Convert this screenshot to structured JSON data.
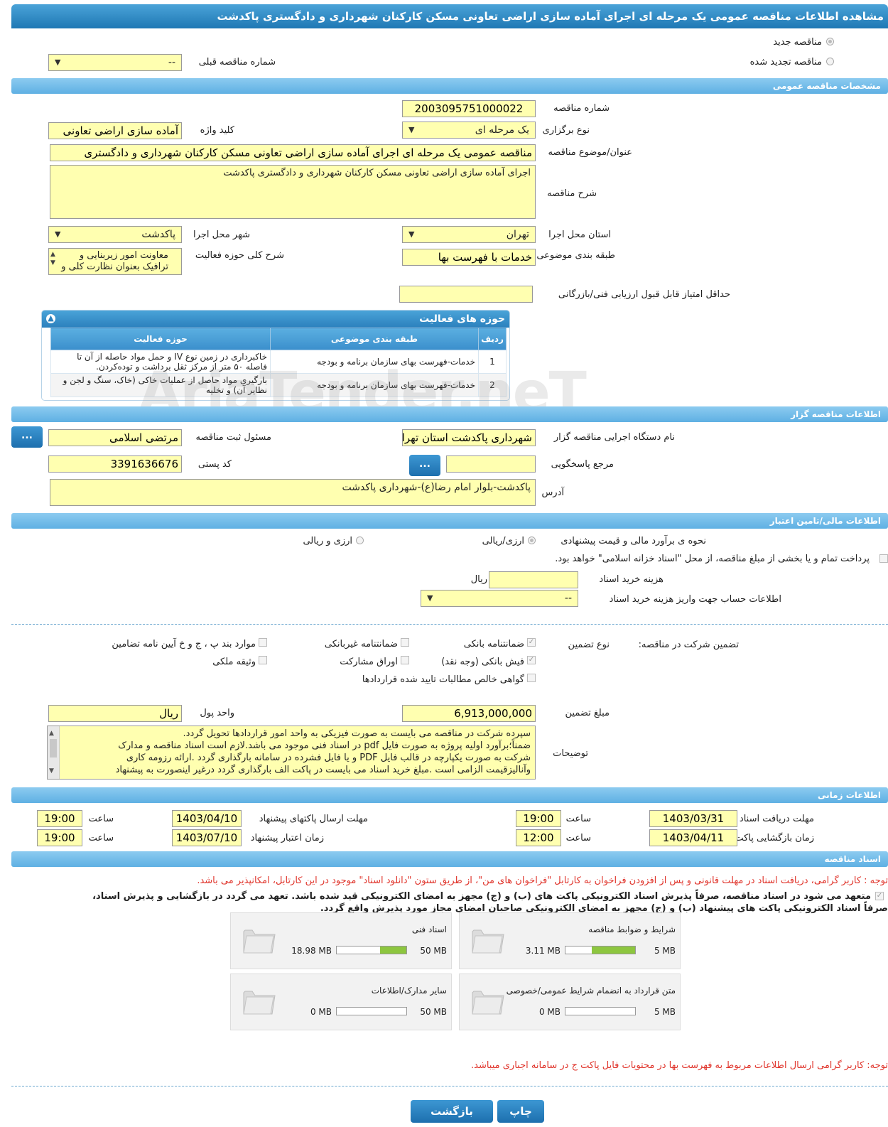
{
  "header": {
    "title": "مشاهده اطلاعات مناقصه عمومی یک مرحله ای اجرای آماده سازی اراضی تعاونی مسکن کارکنان شهرداری و دادگستری پاکدشت"
  },
  "top": {
    "new_tender": "مناقصه جدید",
    "renewed_tender": "مناقصه تجدید شده",
    "prev_number_label": "شماره مناقصه قبلی",
    "prev_number_value": "--"
  },
  "general": {
    "section": "مشخصات مناقصه عمومی",
    "number_label": "شماره مناقصه",
    "number_value": "2003095751000022",
    "type_label": "نوع برگزاری",
    "type_value": "یک مرحله ای",
    "keyword_label": "کلید واژه",
    "keyword_value": "آماده سازی اراضی تعاونی",
    "title_label": "عنوان/موضوع مناقصه",
    "title_value": "مناقصه عمومی یک مرحله ای اجرای آماده سازی اراضی تعاونی مسکن کارکنان شهرداری و دادگستری",
    "desc_label": "شرح مناقصه",
    "desc_value": "اجرای آماده سازی اراضی تعاونی مسکن کارکنان شهرداری و دادگستری پاکدشت",
    "province_label": "استان محل اجرا",
    "province_value": "تهران",
    "city_label": "شهر محل اجرا",
    "city_value": "پاکدشت",
    "category_label": "طبقه بندی موضوعی",
    "category_value": "خدمات با فهرست بها",
    "activity_label": "شرح کلی حوزه فعالیت",
    "activity_line1": "معاونت امور زیربنایی و",
    "activity_line2": "ترافیک بعنوان نظارت کلی و",
    "min_score_label": "حداقل امتیاز قابل قبول ارزیابی فنی/بازرگانی",
    "min_score_value": ""
  },
  "activities": {
    "title": "حوزه های فعالیت",
    "headers": [
      "ردیف",
      "طبقه بندی موضوعی",
      "حوزه فعالیت"
    ],
    "rows": [
      {
        "n": "1",
        "cat": "خدمات-فهرست بهای سازمان برنامه و بودجه",
        "act": "خاکبرداری در زمین نوع IV و حمل مواد حاصله از آن تا فاصله ۵۰ متر از مرکز ثقل برداشت و توده‌کردن."
      },
      {
        "n": "2",
        "cat": "خدمات-فهرست بهای سازمان برنامه و بودجه",
        "act": "بارگیری مواد حاصل از عملیات خاکی (خاک، سنگ و لجن و نظایر آن) و تخلیه"
      }
    ]
  },
  "watermark": "AriaTender.neT",
  "org": {
    "section": "اطلاعات مناقصه گزار",
    "name_label": "نام دستگاه اجرایی مناقصه گزار",
    "name_value": "شهرداری پاکدشت استان تهران",
    "resp_label": "مسئول ثبت مناقصه",
    "resp_value": "مرتضی اسلامی",
    "ref_label": "مرجع پاسخگویی",
    "ref_value": "",
    "postal_label": "کد پستی",
    "postal_value": "3391636676",
    "address_label": "آدرس",
    "address_value": "پاکدشت-بلوار امام رضا(ع)-شهرداری پاکدشت",
    "dots": "..."
  },
  "finance": {
    "section": "اطلاعات مالی/تامین اعتبار",
    "estimate_label": "نحوه ی برآورد مالی و قیمت پیشنهادی",
    "opt_rial": "ارزی/ریالی",
    "opt_fx": "ارزی و ریالی",
    "treasury_text": "پرداخت تمام و یا بخشی از مبلغ مناقصه، از محل \"اسناد خزانه اسلامی\" خواهد بود.",
    "doc_cost_label": "هزینه خرید اسناد",
    "doc_cost_value": "",
    "doc_cost_unit": "ریال",
    "account_label": "اطلاعات حساب جهت واریز هزینه خرید اسناد",
    "account_value": "--"
  },
  "guarantee": {
    "label": "تضمین شرکت در مناقصه:",
    "type_label": "نوع تضمین",
    "opts": [
      "ضمانتنامه بانکی",
      "ضمانتنامه غیربانکی",
      "موارد بند پ ، ج و خ آیین نامه تضامین",
      "فیش بانکی (وجه نقد)",
      "اوراق مشارکت",
      "وثیقه ملکی",
      "گواهی خالص مطالبات تایید شده قراردادها"
    ],
    "amount_label": "مبلغ تضمین",
    "amount_value": "6,913,000,000",
    "currency_label": "واحد پول",
    "currency_value": "ریال",
    "notes_label": "توضیحات",
    "notes_lines": [
      "سپرده شرکت در مناقصه می بایست به صورت فیزیکی به واحد امور قراردادها تحویل گردد.",
      "ضمناً؛برآورد اولیه پروژه به صورت فایل pdf  در اسناد فنی موجود می باشد.لازم است اسناد مناقصه و مدارک",
      "شرکت به صورت یکپارچه در قالب فایل PDF  و یا  فایل فشرده در سامانه بارگذاری گردد .ارائه رزومه کاری",
      "وآنالیزقیمت الزامی است .مبلغ خرید اسناد می بایست در پاکت الف بارگذاری گردد درغیر اینصورت به پیشنهاد"
    ]
  },
  "time": {
    "section": "اطلاعات زمانی",
    "recv_label": "مهلت دریافت اسناد",
    "recv_date": "1403/03/31",
    "recv_time": "19:00",
    "send_label": "مهلت ارسال پاکتهای پیشنهاد",
    "send_date": "1403/04/10",
    "send_time": "19:00",
    "open_label": "زمان بازگشایی پاکت ها",
    "open_date": "1403/04/11",
    "open_time": "12:00",
    "valid_label": "زمان اعتبار پیشنهاد",
    "valid_date": "1403/07/10",
    "valid_time": "19:00",
    "hour_label": "ساعت"
  },
  "docs": {
    "section": "اسناد مناقصه",
    "notice": "توجه : کاربر گرامی، دریافت اسناد در مهلت قانونی و پس از افزودن فراخوان به کارتابل \"فراخوان های من\"، از طریق ستون \"دانلود اسناد\" موجود در این کارتابل، امکانپذیر می باشد.",
    "commit1": "متعهد می شود در اسناد مناقصه، صرفاً پذیرش اسناد الکترونیکی پاکت های (ب) و (ج) مجهز به امضای الکترونیکی قید شده باشد. تعهد می گردد در بازگشایی و پذیرش اسناد،",
    "commit2": "صرفاً اسناد الکترونیکی پاکت های پیشنهاد (ب) و (ج) مجهز به امضای الکترونیکی صاحبان امضای مجاز مورد پذیرش واقع گردد.",
    "cards": [
      {
        "title": "شرایط و ضوابط مناقصه",
        "used": "3.11 MB",
        "max": "5 MB",
        "ratio": 0.622
      },
      {
        "title": "اسناد فنی",
        "used": "18.98 MB",
        "max": "50 MB",
        "ratio": 0.38
      },
      {
        "title": "متن قرارداد به انضمام شرایط عمومی/خصوصی",
        "used": "0 MB",
        "max": "5 MB",
        "ratio": 0
      },
      {
        "title": "سایر مدارک/اطلاعات",
        "used": "0 MB",
        "max": "50 MB",
        "ratio": 0
      }
    ],
    "notice2": "توجه: کاربر گرامی ارسال اطلاعات مربوط به فهرست بها در محتویات فایل پاکت ج در سامانه اجباری میباشد."
  },
  "buttons": {
    "print": "چاپ",
    "back": "بازگشت"
  },
  "colors": {
    "field_bg": "#ffffb0",
    "header_blue": "#1f78b4",
    "progress_green": "#8dc63f",
    "notice_red": "#e0342b"
  }
}
